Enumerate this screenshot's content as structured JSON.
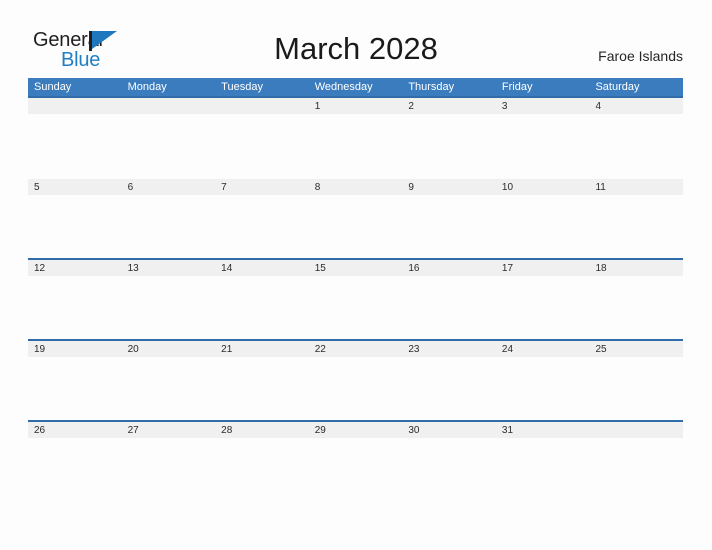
{
  "brand": {
    "name_part1": "General",
    "name_part2": "Blue",
    "flag_color": "#1f78bd",
    "text_color": "#231f20"
  },
  "header": {
    "title": "March 2028",
    "location": "Faroe Islands"
  },
  "theme": {
    "header_blue": "#3b7cbe",
    "row_rule_blue": "#2f6ca8",
    "band_gray": "#f0f0f0",
    "page_background": "#fdfdfd"
  },
  "calendar": {
    "weekdays": [
      "Sunday",
      "Monday",
      "Tuesday",
      "Wednesday",
      "Thursday",
      "Friday",
      "Saturday"
    ],
    "weeks": [
      {
        "days": [
          "",
          "",
          "",
          "1",
          "2",
          "3",
          "4"
        ]
      },
      {
        "days": [
          "5",
          "6",
          "7",
          "8",
          "9",
          "10",
          "11"
        ]
      },
      {
        "days": [
          "12",
          "13",
          "14",
          "15",
          "16",
          "17",
          "18"
        ]
      },
      {
        "days": [
          "19",
          "20",
          "21",
          "22",
          "23",
          "24",
          "25"
        ]
      },
      {
        "days": [
          "26",
          "27",
          "28",
          "29",
          "30",
          "31",
          ""
        ]
      }
    ]
  }
}
